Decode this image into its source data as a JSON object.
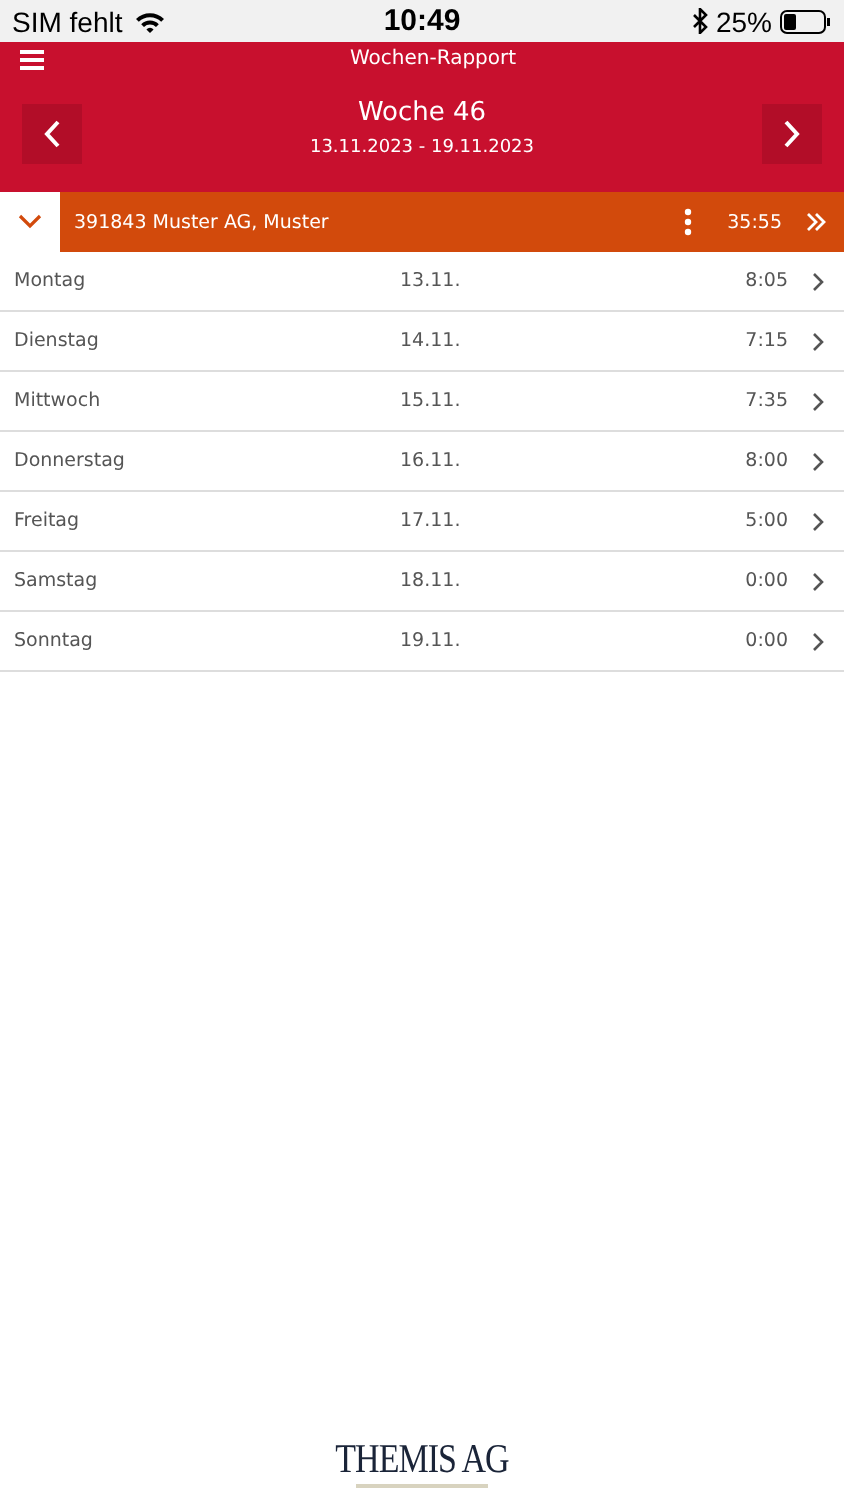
{
  "status_bar": {
    "carrier": "SIM fehlt",
    "time": "10:49",
    "battery": "25%"
  },
  "header": {
    "title": "Wochen-Rapport",
    "week": "Woche 46",
    "range": "13.11.2023 - 19.11.2023"
  },
  "project": {
    "label": "391843 Muster AG, Muster",
    "total": "35:55",
    "expanded": true
  },
  "days": [
    {
      "name": "Montag",
      "date": "13.11.",
      "hours": "8:05"
    },
    {
      "name": "Dienstag",
      "date": "14.11.",
      "hours": "7:15"
    },
    {
      "name": "Mittwoch",
      "date": "15.11.",
      "hours": "7:35"
    },
    {
      "name": "Donnerstag",
      "date": "16.11.",
      "hours": "8:00"
    },
    {
      "name": "Freitag",
      "date": "17.11.",
      "hours": "5:00"
    },
    {
      "name": "Samstag",
      "date": "18.11.",
      "hours": "0:00"
    },
    {
      "name": "Sonntag",
      "date": "19.11.",
      "hours": "0:00"
    }
  ],
  "footer": {
    "logo": "THEMIS AG"
  }
}
